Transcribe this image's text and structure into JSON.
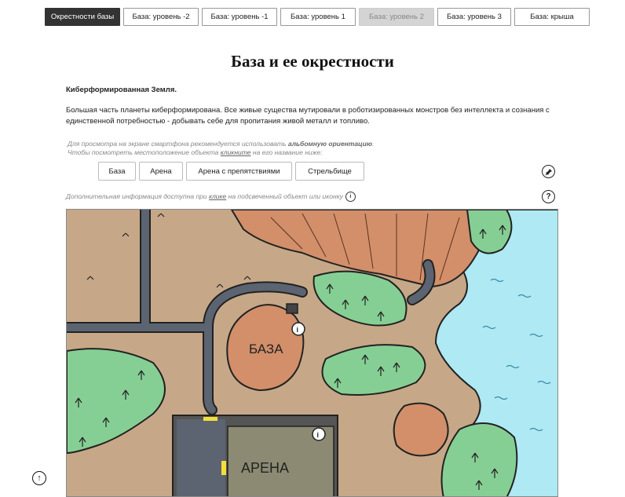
{
  "tabs": [
    {
      "label": "Окрестности базы",
      "state": "active"
    },
    {
      "label": "База: уровень -2",
      "state": "normal"
    },
    {
      "label": "База: уровень -1",
      "state": "normal"
    },
    {
      "label": "База: уровень 1",
      "state": "normal"
    },
    {
      "label": "База: уровень 2",
      "state": "disabled"
    },
    {
      "label": "База: уровень 3",
      "state": "normal"
    },
    {
      "label": "База: крыша",
      "state": "normal"
    }
  ],
  "page": {
    "title": "База и ее окрестности",
    "subtitle": "Киберформированная Земля.",
    "description": "Большая часть планеты киберформирована. Все живые существа мутировали в роботизированных монстров без интеллекта и сознания с единственной потребностью - добывать себе для пропитания живой металл и топливо."
  },
  "hint": {
    "line1_prefix": "Для просмотра на экране смартфона рекомендуется использовать ",
    "line1_bold": "альбомную ориентацию",
    "line1_suffix": ".",
    "line2_prefix": "Чтобы посмотреть местоположение объекта ",
    "line2_link": "кликните",
    "line2_suffix": " на его название ниже:"
  },
  "object_buttons": [
    "База",
    "Арена",
    "Арена с препятствиями",
    "Стрельбище"
  ],
  "info_line": {
    "prefix": "Дополнительная информация доступна при ",
    "link": "клике",
    "suffix": " на подсвеченный объект или иконку"
  },
  "icons": {
    "pin": "pin-icon",
    "help": "question-icon",
    "info": "info-icon",
    "scroll_top": "arrow-up-icon"
  },
  "map": {
    "labels": {
      "base": "БАЗА",
      "arena": "АРЕНА"
    },
    "colors": {
      "ground": "#c6a888",
      "road": "#5b6470",
      "rock": "#d28f6a",
      "grass": "#86cf94",
      "water": "#aee9f4",
      "building": "#8c8a72"
    }
  }
}
